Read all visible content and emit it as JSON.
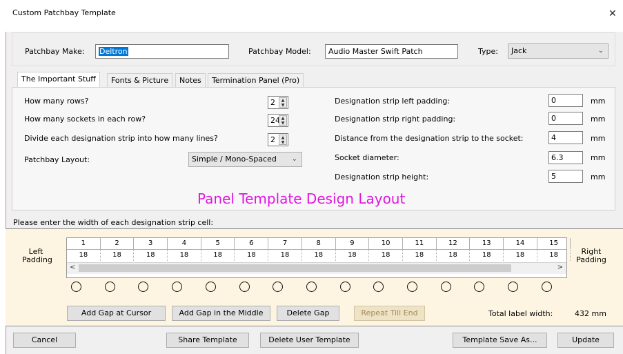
{
  "window": {
    "title": "Custom Patchbay Template",
    "close_glyph": "✕"
  },
  "header": {
    "make_label": "Patchbay Make:",
    "make_value": "Deltron",
    "model_label": "Patchbay Model:",
    "model_value": "Audio Master Swift Patch",
    "type_label": "Type:",
    "type_value": "Jack"
  },
  "tabs": [
    {
      "label": "The Important Stuff",
      "active": true
    },
    {
      "label": "Fonts & Picture",
      "active": false
    },
    {
      "label": "Notes",
      "active": false
    },
    {
      "label": "Termination Panel (Pro)",
      "active": false
    }
  ],
  "left_settings": {
    "rows_label": "How many rows?",
    "rows_value": "2",
    "sockets_label": "How many sockets in each row?",
    "sockets_value": "24",
    "lines_label": "Divide each designation strip into how many lines?",
    "lines_value": "2",
    "layout_label": "Patchbay Layout:",
    "layout_value": "Simple / Mono-Spaced"
  },
  "right_settings": {
    "unit": "mm",
    "items": [
      {
        "label": "Designation strip left padding:",
        "value": "0"
      },
      {
        "label": "Designation strip right padding:",
        "value": "0"
      },
      {
        "label": "Distance from the designation strip to the socket:",
        "value": "4"
      },
      {
        "label": "Socket diameter:",
        "value": "6.3"
      },
      {
        "label": "Designation strip height:",
        "value": "5"
      }
    ]
  },
  "overlay_text": "Panel Template Design Layout",
  "cells_prompt": "Please enter the width of each designation strip cell:",
  "strip": {
    "left_label_1": "Left",
    "left_label_2": "Padding",
    "right_label_1": "Right",
    "right_label_2": "Padding",
    "columns": [
      "1",
      "2",
      "3",
      "4",
      "5",
      "6",
      "7",
      "8",
      "9",
      "10",
      "11",
      "12",
      "13",
      "14",
      "15"
    ],
    "widths": [
      "18",
      "18",
      "18",
      "18",
      "18",
      "18",
      "18",
      "18",
      "18",
      "18",
      "18",
      "18",
      "18",
      "18",
      "18"
    ],
    "socket_count": 15,
    "scroll_left": "<",
    "scroll_right": ">"
  },
  "strip_buttons": {
    "add_gap_cursor": "Add Gap at Cursor",
    "add_gap_middle": "Add Gap in the Middle",
    "delete_gap": "Delete Gap",
    "repeat_till_end": "Repeat Till End",
    "total_label": "Total label width:",
    "total_value": "432 mm"
  },
  "footer": {
    "cancel": "Cancel",
    "share": "Share Template",
    "delete_user": "Delete User Template",
    "save_as": "Template Save As...",
    "update": "Update"
  },
  "colors": {
    "accent": "#e016e0",
    "strip_background": "#fdf5e2",
    "selection": "#0078d7"
  }
}
